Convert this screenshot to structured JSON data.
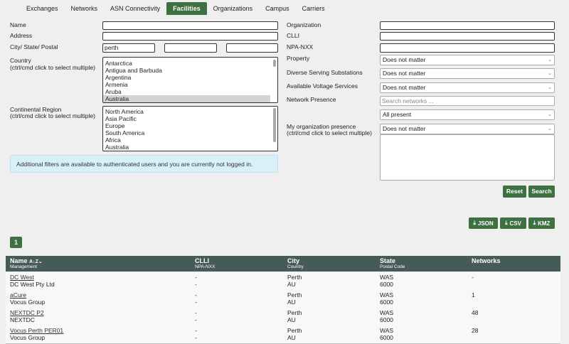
{
  "tabs": [
    {
      "label": "Exchanges"
    },
    {
      "label": "Networks"
    },
    {
      "label": "ASN Connectivity"
    },
    {
      "label": "Facilities"
    },
    {
      "label": "Organizations"
    },
    {
      "label": "Campus"
    },
    {
      "label": "Carriers"
    }
  ],
  "left_form": {
    "name_label": "Name",
    "address_label": "Address",
    "city_label": "City/ State/ Postal",
    "city_value": "perth",
    "state_value": "",
    "postal_value": "",
    "country_label": "Country",
    "country_hint": "(ctrl/cmd click to select multiple)",
    "countries": [
      "Antarctica",
      "Antigua and Barbuda",
      "Argentina",
      "Armenia",
      "Aruba",
      "Australia"
    ],
    "region_label": "Continental Region",
    "region_hint": "(ctrl/cmd click to select multiple)",
    "regions": [
      "North America",
      "Asia Pacific",
      "Europe",
      "South America",
      "Africa",
      "Australia"
    ]
  },
  "info_text": "Additional filters are available to authenticated users and you are currently not logged in.",
  "right_form": {
    "organization_label": "Organization",
    "clli_label": "CLLI",
    "npa_label": "NPA-NXX",
    "property_label": "Property",
    "property_value": "Does not matter",
    "diverse_label": "Diverse Serving Substations",
    "diverse_value": "Does not matter",
    "voltage_label": "Available Voltage Services",
    "voltage_value": "Does not matter",
    "network_presence_label": "Network Presence",
    "network_search_placeholder": "Search networks ...",
    "presence_value": "All present",
    "my_org_label": "My organization presence",
    "my_org_hint": "(ctrl/cmd click to select multiple)",
    "my_org_value": "Does not matter"
  },
  "buttons": {
    "reset": "Reset",
    "search": "Search",
    "json": "JSON",
    "csv": "CSV",
    "kmz": "KMZ"
  },
  "pagination": {
    "current": "1"
  },
  "table": {
    "headers": [
      {
        "title": "Name",
        "sort": "A↓Z",
        "sub": "Management"
      },
      {
        "title": "CLLI",
        "sub": "NPA-NXX"
      },
      {
        "title": "City",
        "sub": "Country"
      },
      {
        "title": "State",
        "sub": "Postal Code"
      },
      {
        "title": "Networks",
        "sub": ""
      }
    ],
    "rows": [
      {
        "name": "DC West",
        "management": "DC West Pty Ltd",
        "clli": "-",
        "npa": "-",
        "city": "Perth",
        "country": "AU",
        "state": "WAS",
        "postal": "6000",
        "networks": "-"
      },
      {
        "name": "aCure",
        "management": "Vocus Group",
        "clli": "-",
        "npa": "-",
        "city": "Perth",
        "country": "AU",
        "state": "WAS",
        "postal": "6000",
        "networks": "1"
      },
      {
        "name": "NEXTDC P2",
        "management": "NEXTDC",
        "clli": "-",
        "npa": "-",
        "city": "Perth",
        "country": "AU",
        "state": "WAS",
        "postal": "6000",
        "networks": "48"
      },
      {
        "name": "Vocus Perth PER01",
        "management": "Vocus Group",
        "clli": "-",
        "npa": "-",
        "city": "Perth",
        "country": "AU",
        "state": "WAS",
        "postal": "6000",
        "networks": "28"
      }
    ]
  },
  "colors": {
    "accent": "#3e7042",
    "table_header": "#465a58",
    "info_bg": "#d8f0f8"
  }
}
